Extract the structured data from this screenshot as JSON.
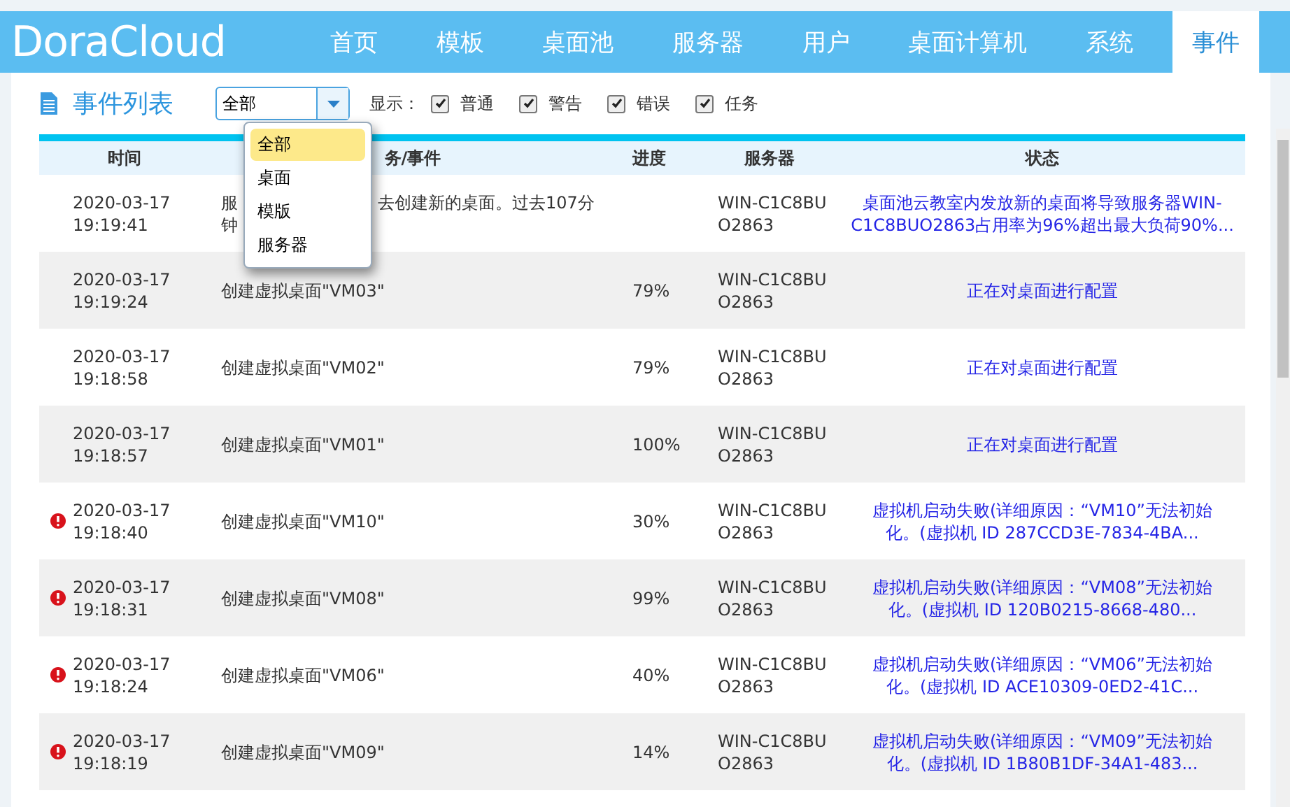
{
  "header": {
    "logo": "DoraCloud",
    "nav": [
      {
        "label": "首页",
        "selected": false
      },
      {
        "label": "模板",
        "selected": false
      },
      {
        "label": "桌面池",
        "selected": false
      },
      {
        "label": "服务器",
        "selected": false
      },
      {
        "label": "用户",
        "selected": false
      },
      {
        "label": "桌面计算机",
        "selected": false
      },
      {
        "label": "系统",
        "selected": false
      },
      {
        "label": "事件",
        "selected": true
      }
    ]
  },
  "toolbar": {
    "title": "事件列表",
    "filter": {
      "value": "全部",
      "expanded": true,
      "options": [
        {
          "label": "全部",
          "selected": true
        },
        {
          "label": "桌面",
          "selected": false
        },
        {
          "label": "模版",
          "selected": false
        },
        {
          "label": "服务器",
          "selected": false
        }
      ]
    },
    "show_label": "显示：",
    "checks": [
      {
        "label": "普通",
        "checked": true
      },
      {
        "label": "警告",
        "checked": true
      },
      {
        "label": "错误",
        "checked": true
      },
      {
        "label": "任务",
        "checked": true
      }
    ]
  },
  "table": {
    "columns": [
      "时间",
      "务/事件",
      "进度",
      "服务器",
      "状态"
    ],
    "rows": [
      {
        "kind": "normal",
        "date": "2020-03-17",
        "time": "19:19:41",
        "task_parts": [
          "服",
          "去创建新的桌面。过去107分",
          "钟"
        ],
        "progress": "",
        "server": [
          "WIN-C1C8BU",
          "O2863"
        ],
        "status": [
          "桌面池云教室内发放新的桌面将导致服务器WIN-",
          "C1C8BUO2863占用率为96%超出最大负荷90%..."
        ]
      },
      {
        "kind": "normal",
        "date": "2020-03-17",
        "time": "19:19:24",
        "task_parts": [
          "创建虚拟桌面\"VM03\""
        ],
        "progress": "79%",
        "server": [
          "WIN-C1C8BU",
          "O2863"
        ],
        "status": [
          "正在对桌面进行配置"
        ]
      },
      {
        "kind": "normal",
        "date": "2020-03-17",
        "time": "19:18:58",
        "task_parts": [
          "创建虚拟桌面\"VM02\""
        ],
        "progress": "79%",
        "server": [
          "WIN-C1C8BU",
          "O2863"
        ],
        "status": [
          "正在对桌面进行配置"
        ]
      },
      {
        "kind": "normal",
        "date": "2020-03-17",
        "time": "19:18:57",
        "task_parts": [
          "创建虚拟桌面\"VM01\""
        ],
        "progress": "100%",
        "server": [
          "WIN-C1C8BU",
          "O2863"
        ],
        "status": [
          "正在对桌面进行配置"
        ]
      },
      {
        "kind": "error",
        "date": "2020-03-17",
        "time": "19:18:40",
        "task_parts": [
          "创建虚拟桌面\"VM10\""
        ],
        "progress": "30%",
        "server": [
          "WIN-C1C8BU",
          "O2863"
        ],
        "status": [
          "虚拟机启动失败(详细原因：“VM10”无法初始",
          "化。(虚拟机 ID 287CCD3E-7834-4BA..."
        ]
      },
      {
        "kind": "error",
        "date": "2020-03-17",
        "time": "19:18:31",
        "task_parts": [
          "创建虚拟桌面\"VM08\""
        ],
        "progress": "99%",
        "server": [
          "WIN-C1C8BU",
          "O2863"
        ],
        "status": [
          "虚拟机启动失败(详细原因：“VM08”无法初始",
          "化。(虚拟机 ID 120B0215-8668-480..."
        ]
      },
      {
        "kind": "error",
        "date": "2020-03-17",
        "time": "19:18:24",
        "task_parts": [
          "创建虚拟桌面\"VM06\""
        ],
        "progress": "40%",
        "server": [
          "WIN-C1C8BU",
          "O2863"
        ],
        "status": [
          "虚拟机启动失败(详细原因：“VM06”无法初始",
          "化。(虚拟机 ID ACE10309-0ED2-41C..."
        ]
      },
      {
        "kind": "error",
        "date": "2020-03-17",
        "time": "19:18:19",
        "task_parts": [
          "创建虚拟桌面\"VM09\""
        ],
        "progress": "14%",
        "server": [
          "WIN-C1C8BU",
          "O2863"
        ],
        "status": [
          "虚拟机启动失败(详细原因：“VM09”无法初始",
          "化。(虚拟机 ID 1B80B1DF-34A1-483..."
        ]
      }
    ]
  }
}
